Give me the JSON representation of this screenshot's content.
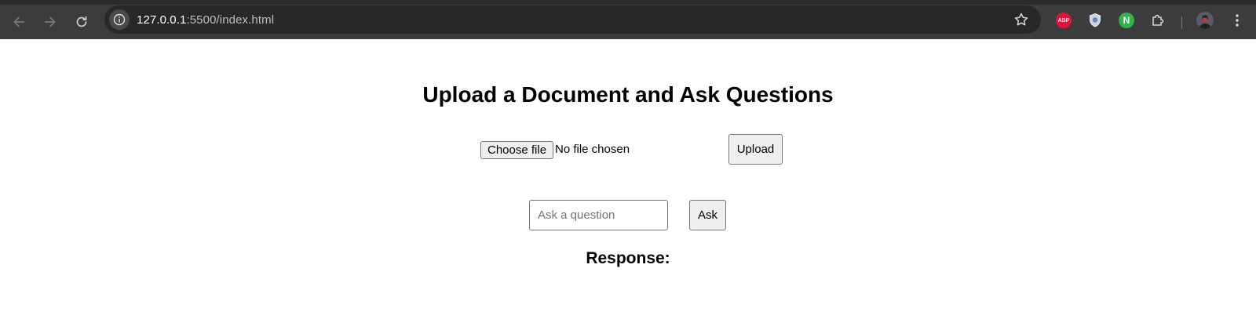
{
  "browser": {
    "url_host": "127.0.0.1",
    "url_rest": ":5500/index.html",
    "extensions": {
      "abp_label": "ABP",
      "n_label": "N"
    }
  },
  "page": {
    "title": "Upload a Document and Ask Questions",
    "choose_file_label": "Choose file",
    "file_status": "No file chosen",
    "upload_label": "Upload",
    "question_placeholder": "Ask a question",
    "question_value": "",
    "ask_label": "Ask",
    "response_heading": "Response:"
  },
  "icons": [
    "back-icon",
    "forward-icon",
    "reload-icon",
    "site-info-icon",
    "bookmark-star-icon",
    "adblock-plus-icon",
    "shield-extension-icon",
    "n-extension-icon",
    "extensions-puzzle-icon",
    "profile-avatar",
    "menu-kebab-icon"
  ],
  "colors": {
    "chrome_bg": "#3c3c3c",
    "omnibox_bg": "#282828",
    "abp_red": "#e4123a",
    "n_green": "#2fb34a"
  }
}
